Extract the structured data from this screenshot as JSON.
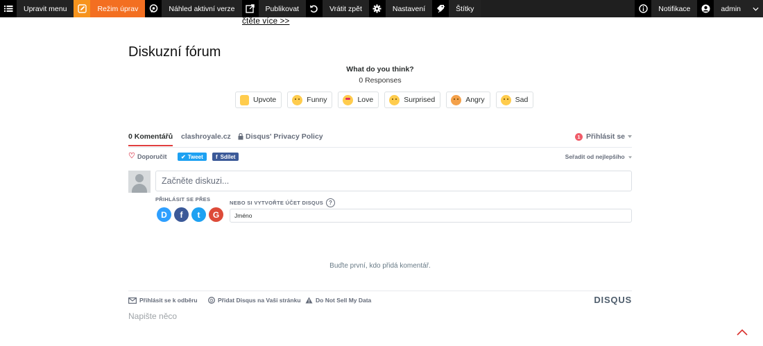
{
  "toolbar": {
    "edit_menu": "Upravit menu",
    "edit_mode": "Režim úprav",
    "preview": "Náhled aktivní verze",
    "publish": "Publikovat",
    "revert": "Vrátit zpět",
    "settings": "Nastavení",
    "tags": "Štítky",
    "notifications": "Notifikace",
    "user": "admin",
    "accent_color": "#f7941d"
  },
  "content": {
    "read_more": "čtěte více >>",
    "title": "Diskuzní fórum"
  },
  "reactions": {
    "question": "What do you think?",
    "responses": "0 Responses",
    "items": [
      {
        "label": "Upvote",
        "icon": "thumbs-up-icon"
      },
      {
        "label": "Funny",
        "icon": "laughing-face-icon"
      },
      {
        "label": "Love",
        "icon": "heart-eyes-face-icon"
      },
      {
        "label": "Surprised",
        "icon": "surprised-face-icon"
      },
      {
        "label": "Angry",
        "icon": "angry-face-icon"
      },
      {
        "label": "Sad",
        "icon": "sad-face-icon"
      }
    ]
  },
  "disqus": {
    "tab_comments": "0 Komentářů",
    "tab_site": "clashroyale.cz",
    "tab_privacy": "Disqus' Privacy Policy",
    "login_badge": "1",
    "login": "Přihlásit se",
    "recommend": "Doporučit",
    "tweet": "Tweet",
    "share": "Sdílet",
    "sort": "Seřadit od nejlepšího",
    "compose_placeholder": "Začněte diskuzi...",
    "login_via": "PŘIHLÁSIT SE PŘES",
    "social": [
      "D",
      "f",
      "t",
      "G"
    ],
    "or_create": "NEBO SI VYTVOŘTE ÚČET DISQUS",
    "help": "?",
    "name_placeholder": "Jméno",
    "empty": "Buďte první, kdo přidá komentář.",
    "footer_subscribe": "Přihlásit se k odběru",
    "footer_add": "Přidat Disqus na Vaši stránku",
    "footer_dnsmd": "Do Not Sell My Data",
    "logo": "DISQUS"
  },
  "write_something": "Napište něco"
}
